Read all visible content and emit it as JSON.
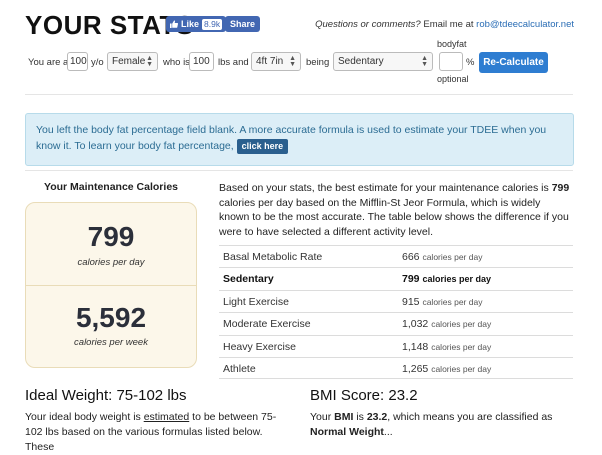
{
  "header": {
    "title": "YOUR STATS",
    "like_label": "Like",
    "like_count": "8.9k",
    "share_label": "Share",
    "contact_question": "Questions or comments?",
    "contact_text": "Email me at",
    "contact_email": "rob@tdeecalculator.net"
  },
  "form": {
    "you_are_a": "You are a",
    "age": "100",
    "age_unit": "y/o",
    "gender": "Female",
    "who_is": "who is",
    "weight": "100",
    "weight_unit": "lbs and",
    "height": "4ft 7in",
    "being": "being",
    "activity": "Sedentary",
    "bodyfat_label": "bodyfat",
    "bodyfat_value": "",
    "bodyfat_unit": "%",
    "optional_label": "optional",
    "recalc_label": "Re-Calculate"
  },
  "alert": {
    "text": "You left the body fat percentage field blank. A more accurate formula is used to estimate your TDEE when you know it. To learn your body fat percentage,",
    "link_label": "click here"
  },
  "maintenance": {
    "heading": "Your Maintenance Calories",
    "daily_value": "799",
    "daily_label": "calories per day",
    "weekly_value": "5,592",
    "weekly_label": "calories per week"
  },
  "description": {
    "p1": "Based on your stats, the best estimate for your maintenance calories is",
    "p_bold": "799",
    "p2": "calories per day based on the Mifflin-St Jeor Formula, which is widely known to be the most accurate. The table below shows the difference if you were to have selected a different activity level."
  },
  "activity_table": {
    "unit": "calories per day",
    "rows": [
      {
        "label": "Basal Metabolic Rate",
        "value": "666",
        "selected": false
      },
      {
        "label": "Sedentary",
        "value": "799",
        "selected": true
      },
      {
        "label": "Light Exercise",
        "value": "915",
        "selected": false
      },
      {
        "label": "Moderate Exercise",
        "value": "1,032",
        "selected": false
      },
      {
        "label": "Heavy Exercise",
        "value": "1,148",
        "selected": false
      },
      {
        "label": "Athlete",
        "value": "1,265",
        "selected": false
      }
    ]
  },
  "ideal_weight": {
    "heading": "Ideal Weight: 75-102 lbs",
    "t1": "Your ideal body weight is",
    "t_link": "estimated",
    "t2": "to be between 75-102 lbs based on the various formulas listed below. These"
  },
  "bmi": {
    "heading": "BMI Score: 23.2",
    "t1": "Your",
    "t_bmi": "BMI",
    "t2": "is",
    "t_value": "23.2",
    "t3": ", which means you are classified as",
    "t_class": "Normal Weight",
    "t4": "..."
  },
  "colors": {
    "facebook": "#4267b2",
    "button": "#2e7dd1",
    "alert_bg": "#dceef7",
    "card_bg": "#fcf7ea"
  }
}
